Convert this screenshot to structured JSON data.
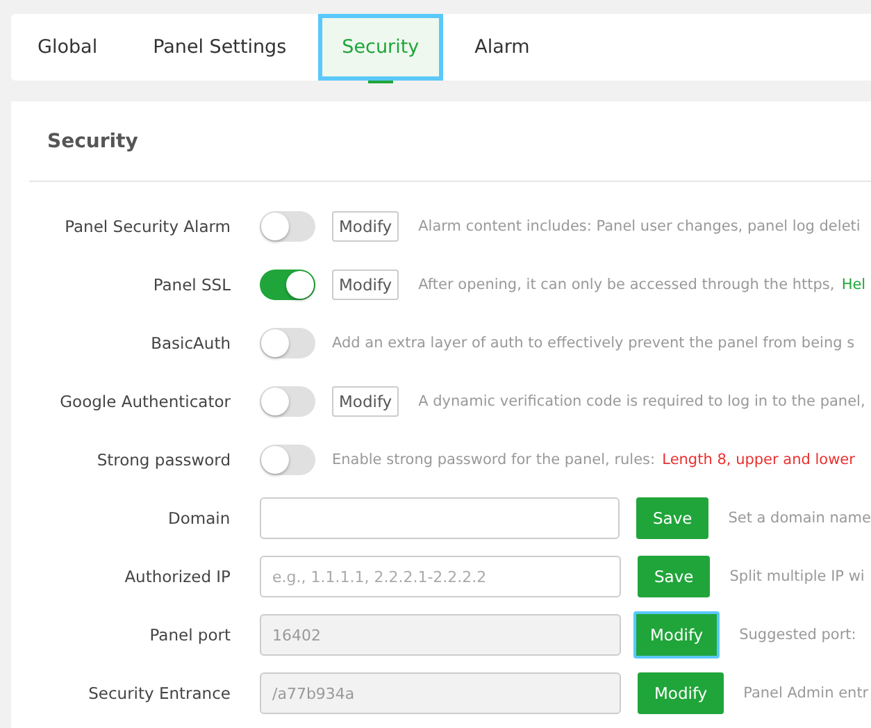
{
  "tabs": [
    {
      "label": "Global",
      "selected": false,
      "focused": false
    },
    {
      "label": "Panel Settings",
      "selected": false,
      "focused": false
    },
    {
      "label": "Security",
      "selected": true,
      "focused": true
    },
    {
      "label": "Alarm",
      "selected": false,
      "focused": false
    }
  ],
  "section": {
    "title": "Security"
  },
  "rows": [
    {
      "kind": "toggle",
      "label": "Panel Security Alarm",
      "on": false,
      "button": "Modify",
      "hint": "Alarm content includes: Panel user changes, panel log deleti"
    },
    {
      "kind": "toggle",
      "label": "Panel SSL",
      "on": true,
      "button": "Modify",
      "hint": "After opening, it can only be accessed through the https,",
      "link": "Hel"
    },
    {
      "kind": "toggle",
      "label": "BasicAuth",
      "on": false,
      "hint": "Add an extra layer of auth to effectively prevent the panel from being s"
    },
    {
      "kind": "toggle",
      "label": "Google Authenticator",
      "on": false,
      "button": "Modify",
      "hint": "A dynamic verification code is required to log in to the panel,"
    },
    {
      "kind": "toggle",
      "label": "Strong password",
      "on": false,
      "hint": "Enable strong password for the panel, rules:",
      "warning": "Length 8, upper and lower"
    },
    {
      "kind": "input",
      "label": "Domain",
      "disabled": false,
      "button": "Save",
      "focused": false,
      "hint": "Set a domain name"
    },
    {
      "kind": "input",
      "label": "Authorized IP",
      "placeholder": "e.g., 1.1.1.1, 2.2.2.1-2.2.2.2",
      "disabled": false,
      "button": "Save",
      "focused": false,
      "hint": "Split multiple IP wi"
    },
    {
      "kind": "input",
      "label": "Panel port",
      "value": "16402",
      "disabled": true,
      "button": "Modify",
      "focused": true,
      "hint": "Suggested port:"
    },
    {
      "kind": "input",
      "label": "Security Entrance",
      "value": "/a77b934a",
      "disabled": true,
      "button": "Modify",
      "focused": false,
      "hint": "Panel Admin entr"
    }
  ]
}
